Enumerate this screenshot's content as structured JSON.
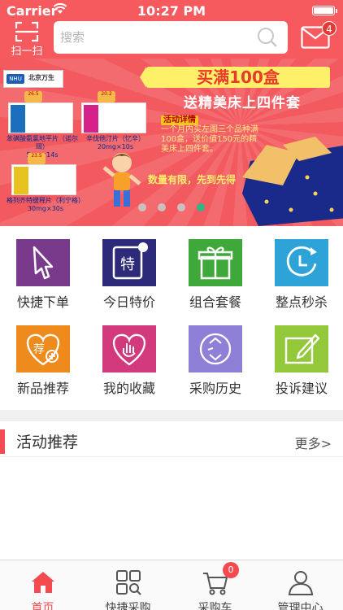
{
  "status_bar": {
    "carrier": "Carrier",
    "time": "10:27 PM"
  },
  "header": {
    "scan_label": "扫一扫",
    "search_placeholder": "搜索",
    "message_count": "4"
  },
  "banner": {
    "brand_name": "北京万生",
    "brand_logo": "NHU",
    "headline": "买满100盒",
    "subheadline": "送精美床上四件套",
    "detail_tag": "活动详情",
    "detail_text": "一个月内买左图三个品种满100盒，送价值150元的精美床上四件套。",
    "limit_text": "数量有限，先到先得",
    "products": [
      {
        "name": "苯磺酸氨氯地平片（诺尔珥）",
        "spec": "5mg×14s",
        "price": "26.5",
        "color": "#1b6fbd"
      },
      {
        "name": "辛伐他汀片（忆辛）",
        "spec": "20mg×10s",
        "price": "20.2",
        "color": "#d6208a"
      },
      {
        "name": "格列齐特缓释片（利宁格）",
        "spec": "30mg×30s",
        "price": "23.5",
        "color": "#e8c21f"
      }
    ],
    "active_dot": 3,
    "dot_count": 4
  },
  "grid": [
    {
      "label": "快捷下单",
      "icon": "hand-pointer-icon",
      "color": "#7a3a8c"
    },
    {
      "label": "今日特价",
      "icon": "special-price-icon",
      "color": "#2e2a7a"
    },
    {
      "label": "组合套餐",
      "icon": "gift-icon",
      "color": "#3fa83a"
    },
    {
      "label": "整点秒杀",
      "icon": "clock-arrow-icon",
      "color": "#2ea3d8"
    },
    {
      "label": "新品推荐",
      "icon": "recommend-icon",
      "color": "#ef8a1d"
    },
    {
      "label": "我的收藏",
      "icon": "heart-hand-icon",
      "color": "#d23a7d"
    },
    {
      "label": "采购历史",
      "icon": "recycle-icon",
      "color": "#8f7fd6"
    },
    {
      "label": "投诉建议",
      "icon": "edit-icon",
      "color": "#92c83a"
    }
  ],
  "section": {
    "title": "活动推荐",
    "more": "更多>"
  },
  "tabbar": [
    {
      "label": "首页",
      "icon": "home-icon",
      "active": true
    },
    {
      "label": "快捷采购",
      "icon": "grid-search-icon",
      "active": false
    },
    {
      "label": "采购车",
      "icon": "cart-icon",
      "active": false,
      "badge": "0"
    },
    {
      "label": "管理中心",
      "icon": "user-icon",
      "active": false
    }
  ],
  "colors": {
    "brand": "#f75a5e",
    "accent_red": "#f34b4f",
    "active_dot": "#1cbf8c"
  }
}
